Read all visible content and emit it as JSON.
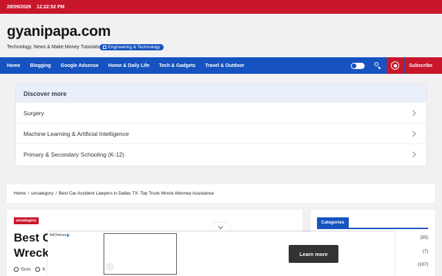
{
  "topbar": {
    "date": "28/09/2026",
    "time": "12:22:52 PM"
  },
  "site": {
    "title": "gyanipapa.com",
    "tagline": "Technology, News & Make Money Tutorials",
    "tag_pill": "Engineering & Technology"
  },
  "nav": {
    "items": [
      "Home",
      "Blogging",
      "Google Adsense",
      "Home & Daily Life",
      "Tech & Gadgets",
      "Travel & Outdoor"
    ],
    "subscribe": "Subscribe"
  },
  "discover": {
    "heading": "Discover more",
    "items": [
      "Surgery",
      "Machine Learning & Artificial Intelligence",
      "Primary & Secondary Schooling (K-12)"
    ]
  },
  "breadcrumb": [
    "Home",
    "uncategory",
    "Best Car Accident Lawyers in Dallas TX: Top Truck Wreck Attorney Assistance"
  ],
  "article": {
    "category": "uncategory",
    "title_line1": "Best C",
    "title_line2": "Wreck",
    "author": "Guru",
    "date_partial": "8"
  },
  "sidebar": {
    "heading": "Categories",
    "counts": [
      "(55)",
      "(7)",
      "(107)"
    ]
  },
  "ad": {
    "adchoices": "AdChoices",
    "cta": "Learn more"
  },
  "colors": {
    "brand_red": "#c8172b",
    "brand_blue": "#1653c0"
  }
}
